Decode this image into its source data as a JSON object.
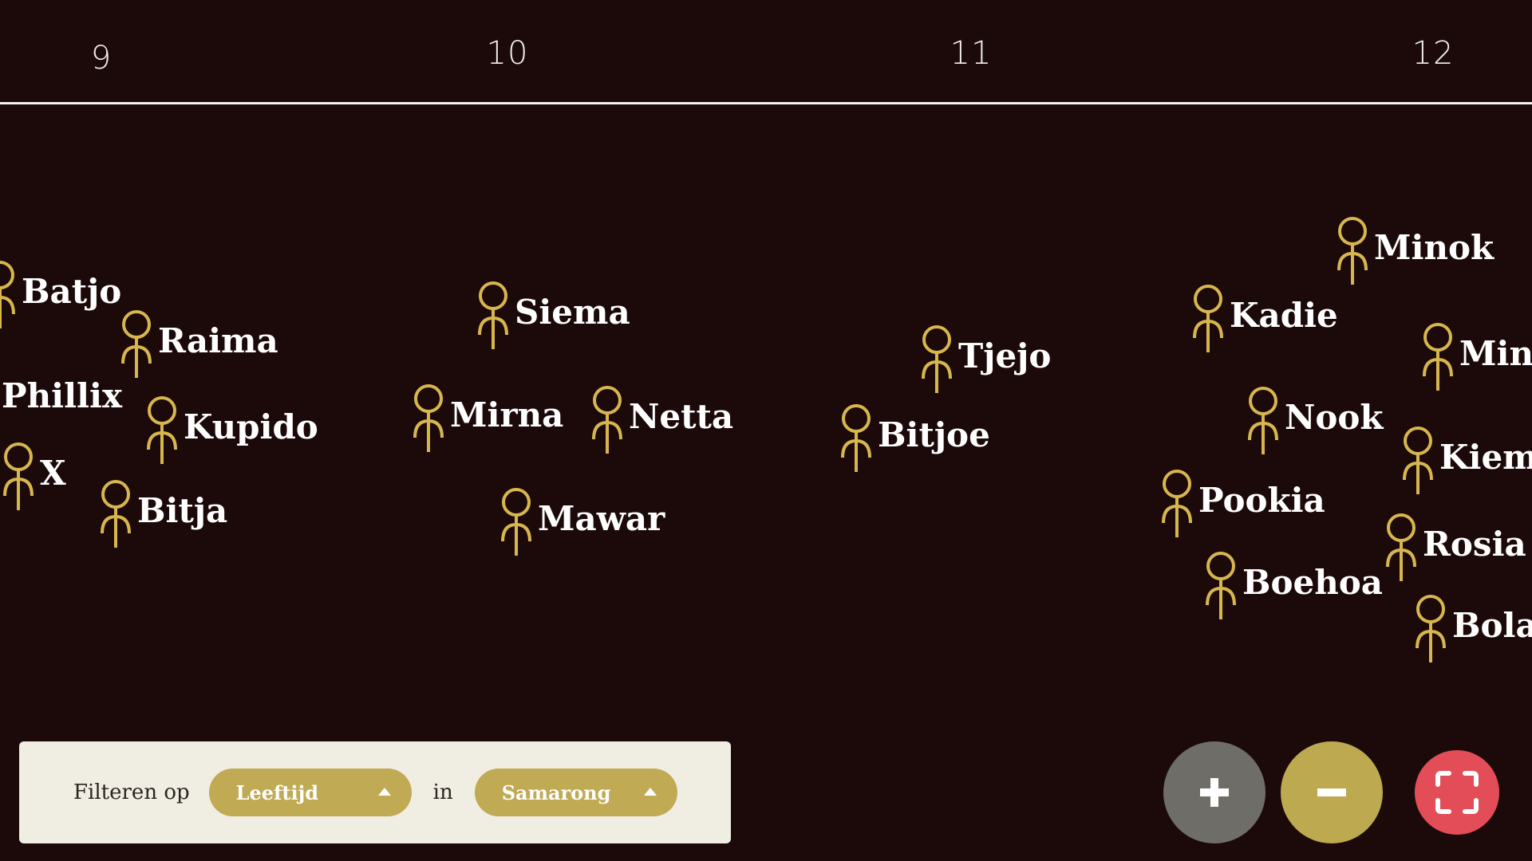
{
  "timeline": {
    "ticks": [
      "9",
      "10",
      "11",
      "12"
    ]
  },
  "people": [
    {
      "name": "Batjo"
    },
    {
      "name": "Raima"
    },
    {
      "name": "Phillix"
    },
    {
      "name": "Kupido"
    },
    {
      "name": "X"
    },
    {
      "name": "Bitja"
    },
    {
      "name": "Siema"
    },
    {
      "name": "Mirna"
    },
    {
      "name": "Netta"
    },
    {
      "name": "Mawar"
    },
    {
      "name": "Tjejo"
    },
    {
      "name": "Bitjoe"
    },
    {
      "name": "Minok"
    },
    {
      "name": "Kadie"
    },
    {
      "name": "Ming"
    },
    {
      "name": "Nook"
    },
    {
      "name": "Kiemb"
    },
    {
      "name": "Pookia"
    },
    {
      "name": "Rosia"
    },
    {
      "name": "Boehoa"
    },
    {
      "name": "Bola"
    }
  ],
  "filter": {
    "label": "Filteren op",
    "first_select": "Leeftijd",
    "connector": "in",
    "second_select": "Samarong"
  },
  "controls": {
    "zoom_in_icon": "plus-icon",
    "zoom_out_icon": "minus-icon",
    "fullscreen_icon": "fullscreen-icon"
  },
  "colors": {
    "background": "#1b0a09",
    "figure": "#d8b64e",
    "panel": "#f0ede3",
    "select": "#c0aa54",
    "zoom_in": "#6f6d68",
    "zoom_out": "#bda950",
    "fullscreen": "#e24d58"
  }
}
